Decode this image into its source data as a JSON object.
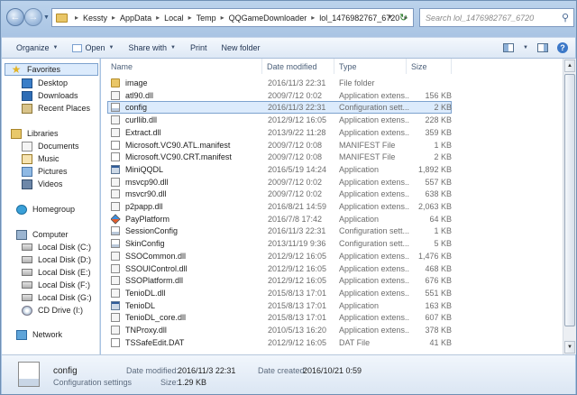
{
  "address": {
    "crumbs": [
      "Kessty",
      "AppData",
      "Local",
      "Temp",
      "QQGameDownloader",
      "lol_1476982767_6720"
    ],
    "search_placeholder": "Search lol_1476982767_6720"
  },
  "toolbar": {
    "organize": "Organize",
    "open": "Open",
    "share": "Share with",
    "print": "Print",
    "new_folder": "New folder"
  },
  "nav": {
    "favorites": "Favorites",
    "desktop": "Desktop",
    "downloads": "Downloads",
    "recent": "Recent Places",
    "libraries": "Libraries",
    "documents": "Documents",
    "music": "Music",
    "pictures": "Pictures",
    "videos": "Videos",
    "homegroup": "Homegroup",
    "computer": "Computer",
    "disk_c": "Local Disk (C:)",
    "disk_d": "Local Disk (D:)",
    "disk_e": "Local Disk (E:)",
    "disk_f": "Local Disk (F:)",
    "disk_g": "Local Disk (G:)",
    "cd": "CD Drive (I:)",
    "network": "Network"
  },
  "columns": {
    "name": "Name",
    "date": "Date modified",
    "type": "Type",
    "size": "Size"
  },
  "files": [
    {
      "name": "image",
      "date": "2016/11/3 22:31",
      "type": "File folder",
      "size": "",
      "icon": "folder"
    },
    {
      "name": "atl90.dll",
      "date": "2009/7/12 0:02",
      "type": "Application extens...",
      "size": "156 KB",
      "icon": "dll"
    },
    {
      "name": "config",
      "date": "2016/11/3 22:31",
      "type": "Configuration sett...",
      "size": "2 KB",
      "icon": "cfg"
    },
    {
      "name": "curllib.dll",
      "date": "2012/9/12 16:05",
      "type": "Application extens...",
      "size": "228 KB",
      "icon": "dll"
    },
    {
      "name": "Extract.dll",
      "date": "2013/9/22 11:28",
      "type": "Application extens...",
      "size": "359 KB",
      "icon": "dll"
    },
    {
      "name": "Microsoft.VC90.ATL.manifest",
      "date": "2009/7/12 0:08",
      "type": "MANIFEST File",
      "size": "1 KB",
      "icon": "manifest"
    },
    {
      "name": "Microsoft.VC90.CRT.manifest",
      "date": "2009/7/12 0:08",
      "type": "MANIFEST File",
      "size": "2 KB",
      "icon": "manifest"
    },
    {
      "name": "MiniQQDL",
      "date": "2016/5/19 14:24",
      "type": "Application",
      "size": "1,892 KB",
      "icon": "app"
    },
    {
      "name": "msvcp90.dll",
      "date": "2009/7/12 0:02",
      "type": "Application extens...",
      "size": "557 KB",
      "icon": "dll"
    },
    {
      "name": "msvcr90.dll",
      "date": "2009/7/12 0:02",
      "type": "Application extens...",
      "size": "638 KB",
      "icon": "dll"
    },
    {
      "name": "p2papp.dll",
      "date": "2016/8/21 14:59",
      "type": "Application extens...",
      "size": "2,063 KB",
      "icon": "dll"
    },
    {
      "name": "PayPlatform",
      "date": "2016/7/8 17:42",
      "type": "Application",
      "size": "64 KB",
      "icon": "pay"
    },
    {
      "name": "SessionConfig",
      "date": "2016/11/3 22:31",
      "type": "Configuration sett...",
      "size": "1 KB",
      "icon": "cfg"
    },
    {
      "name": "SkinConfig",
      "date": "2013/11/19 9:36",
      "type": "Configuration sett...",
      "size": "5 KB",
      "icon": "cfg"
    },
    {
      "name": "SSOCommon.dll",
      "date": "2012/9/12 16:05",
      "type": "Application extens...",
      "size": "1,476 KB",
      "icon": "dll"
    },
    {
      "name": "SSOUIControl.dll",
      "date": "2012/9/12 16:05",
      "type": "Application extens...",
      "size": "468 KB",
      "icon": "dll"
    },
    {
      "name": "SSOPlatform.dll",
      "date": "2012/9/12 16:05",
      "type": "Application extens...",
      "size": "676 KB",
      "icon": "dll"
    },
    {
      "name": "TenioDL.dll",
      "date": "2015/8/13 17:01",
      "type": "Application extens...",
      "size": "551 KB",
      "icon": "dll"
    },
    {
      "name": "TenioDL",
      "date": "2015/8/13 17:01",
      "type": "Application",
      "size": "163 KB",
      "icon": "app"
    },
    {
      "name": "TenioDL_core.dll",
      "date": "2015/8/13 17:01",
      "type": "Application extens...",
      "size": "607 KB",
      "icon": "dll"
    },
    {
      "name": "TNProxy.dll",
      "date": "2010/5/13 16:20",
      "type": "Application extens...",
      "size": "378 KB",
      "icon": "dll"
    },
    {
      "name": "TSSafeEdit.DAT",
      "date": "2012/9/12 16:05",
      "type": "DAT File",
      "size": "41 KB",
      "icon": "dat"
    }
  ],
  "details": {
    "name": "config",
    "type": "Configuration settings",
    "modified_label": "Date modified:",
    "modified": "2016/11/3 22:31",
    "created_label": "Date created:",
    "created": "2016/10/21 0:59",
    "size_label": "Size:",
    "size": "1.29 KB"
  }
}
